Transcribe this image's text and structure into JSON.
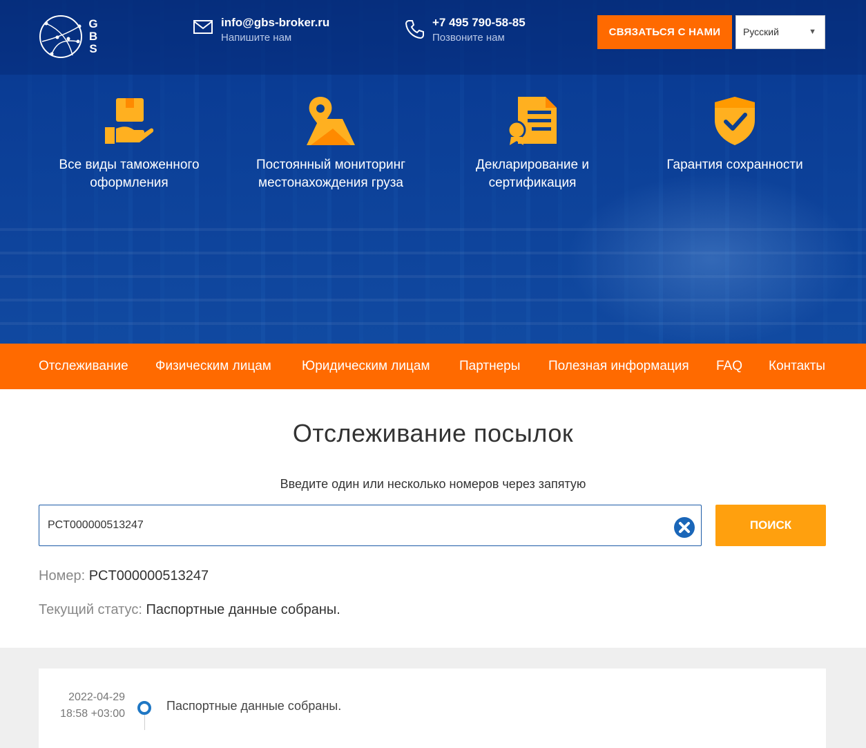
{
  "header": {
    "logo_letters": [
      "G",
      "B",
      "S"
    ],
    "email": {
      "main": "info@gbs-broker.ru",
      "sub": "Напишите нам",
      "icon": "mail-icon"
    },
    "phone": {
      "main": "+7 495 790-58-85",
      "sub": "Позвоните нам",
      "icon": "phone-icon"
    },
    "cta_label": "СВЯЗАТЬСЯ С НАМИ",
    "language": {
      "selected": "Русский"
    }
  },
  "features": [
    {
      "label": "Все виды таможенного оформления",
      "icon": "package-hand-icon"
    },
    {
      "label": "Постоянный мониторинг местонахождения груза",
      "icon": "map-pin-icon"
    },
    {
      "label": "Декларирование и сертификация",
      "icon": "certificate-icon"
    },
    {
      "label": "Гарантия сохранности",
      "icon": "shield-check-icon"
    }
  ],
  "nav": {
    "items": [
      "Отслеживание",
      "Физическим лицам",
      "Юридическим лицам",
      "Партнеры",
      "Полезная информация",
      "FAQ",
      "Контакты"
    ]
  },
  "tracking": {
    "title": "Отслеживание посылок",
    "hint": "Введите один или несколько номеров через запятую",
    "input_value": "PCT000000513247",
    "search_label": "ПОИСК",
    "number_key": "Номер:",
    "number_value": "PCT000000513247",
    "status_key": "Текущий статус:",
    "status_value": "Паспортные данные собраны."
  },
  "history": [
    {
      "date": "2022-04-29",
      "time": "18:58 +03:00",
      "text": "Паспортные данные собраны."
    }
  ],
  "colors": {
    "primary_blue": "#0a3a8a",
    "orange": "#ff6a00",
    "search_orange": "#ffa00e",
    "icon_yellow": "#ffb020"
  }
}
